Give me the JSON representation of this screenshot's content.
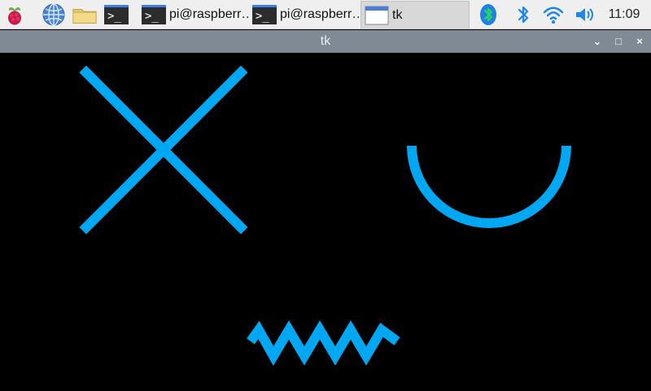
{
  "taskbar": {
    "launchers": [
      {
        "icon": "raspberry-menu-icon"
      },
      {
        "icon": "web-browser-icon"
      },
      {
        "icon": "file-manager-icon"
      },
      {
        "icon": "terminal-icon"
      }
    ],
    "tasks": [
      {
        "label": "pi@raspberr…",
        "icon": "terminal-icon"
      },
      {
        "label": "pi@raspberr…",
        "icon": "terminal-icon"
      },
      {
        "label": "tk",
        "icon": "window-icon"
      }
    ],
    "tray": {
      "bluetooth_status_icon": "bluetooth-status-icon",
      "bluetooth_icon": "bluetooth-icon",
      "wifi_icon": "wifi-icon",
      "volume_icon": "volume-icon",
      "time": "11:09"
    }
  },
  "window": {
    "title": "tk",
    "controls": {
      "minimize": "⌄",
      "maximize": "□",
      "close": "×"
    }
  },
  "canvas": {
    "stroke_color": "#00a8f3",
    "shapes": [
      {
        "type": "x-cross"
      },
      {
        "type": "arc"
      },
      {
        "type": "zigzag"
      }
    ]
  }
}
